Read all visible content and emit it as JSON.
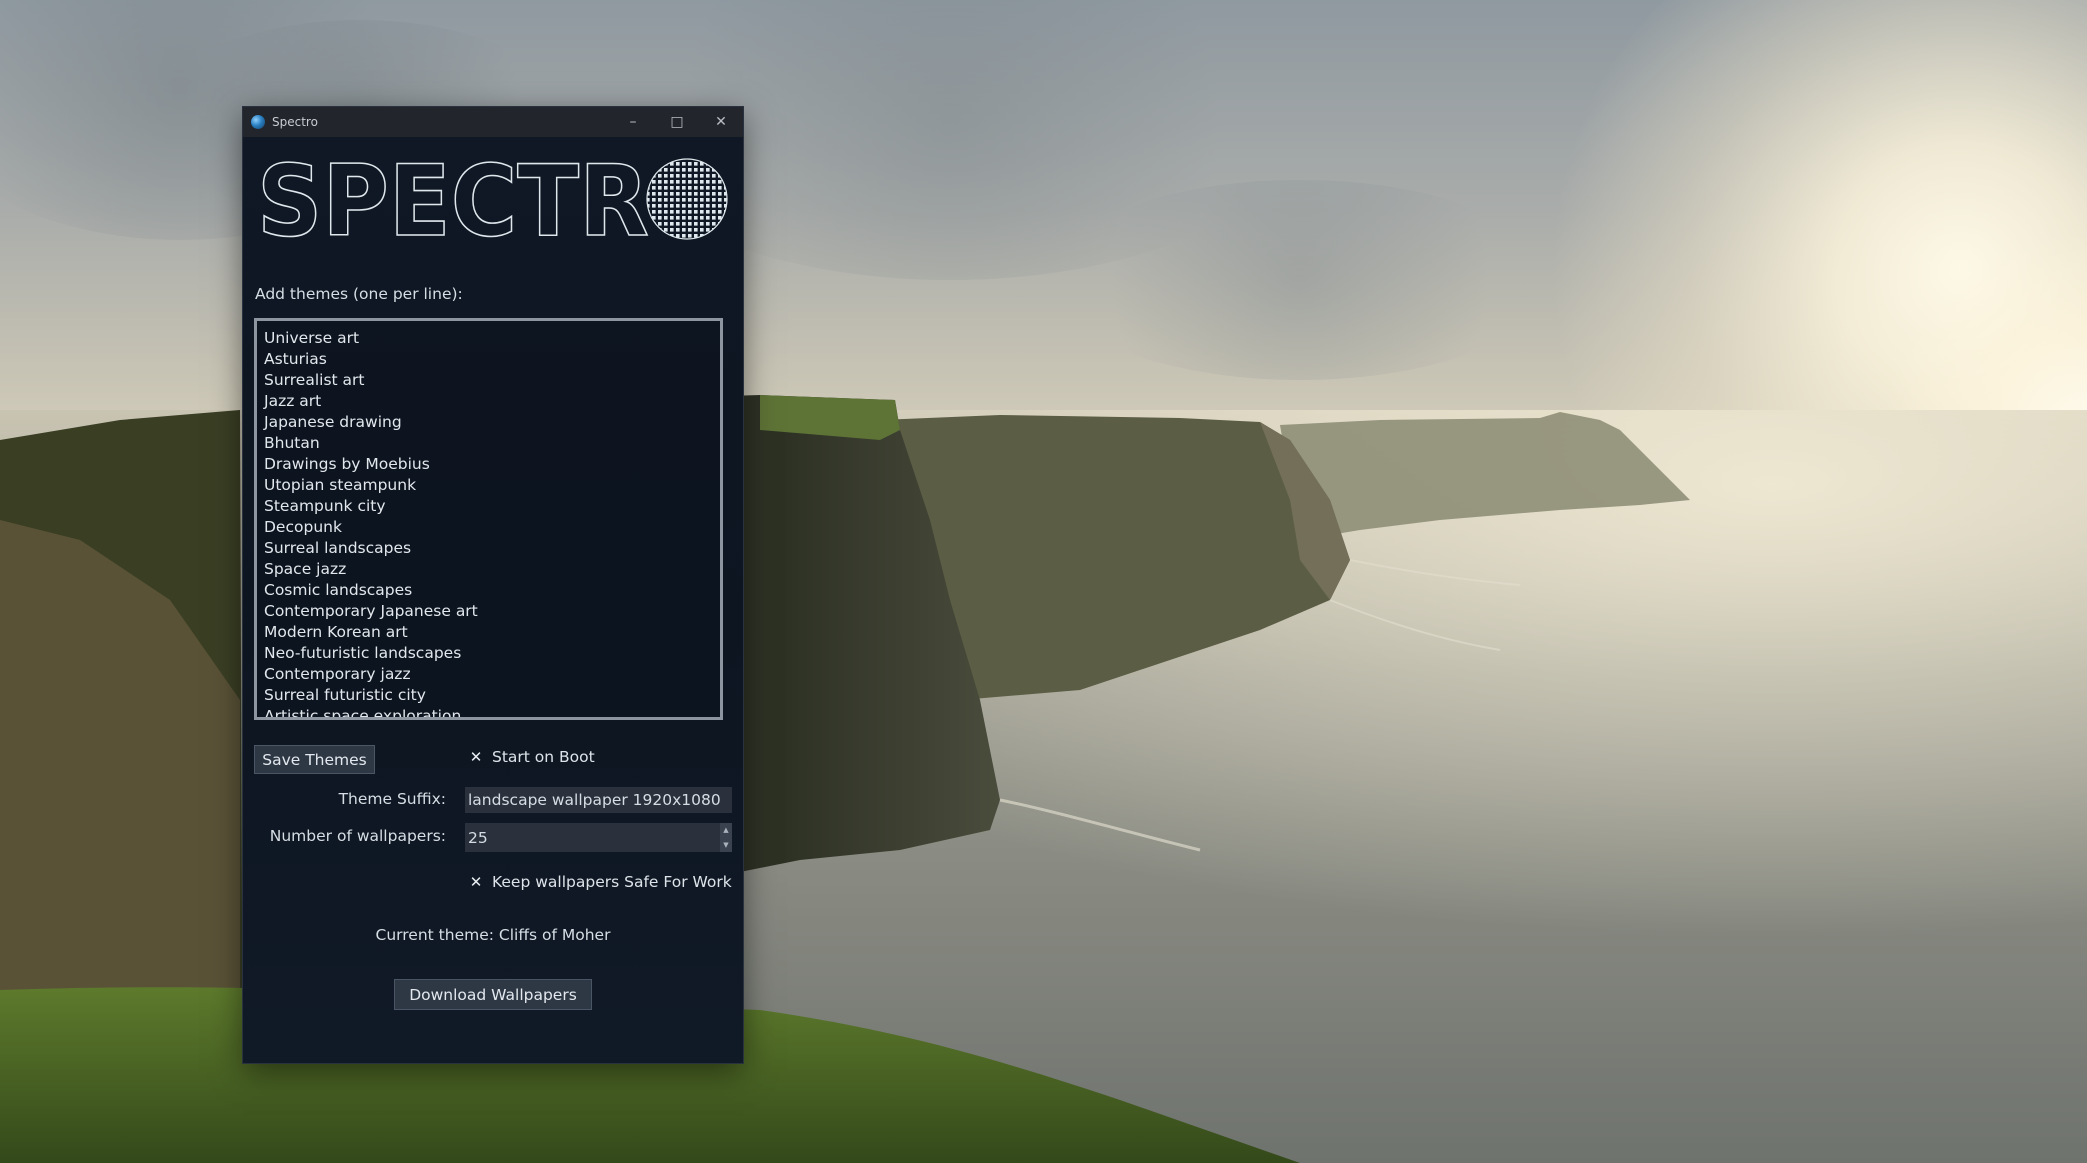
{
  "window": {
    "title": "Spectro",
    "controls": {
      "minimize": "–",
      "maximize": "□",
      "close": "✕"
    }
  },
  "logo": {
    "text": "SPECTR"
  },
  "themes": {
    "label": "Add themes (one per line):",
    "items": [
      "Universe art",
      "Asturias",
      "Surrealist art",
      "Jazz art",
      "Japanese drawing",
      "Bhutan",
      "Drawings by Moebius",
      "Utopian steampunk",
      "Steampunk city",
      "Decopunk",
      "Surreal landscapes",
      "Space jazz",
      "Cosmic landscapes",
      "Contemporary Japanese art",
      "Modern Korean art",
      "Neo-futuristic landscapes",
      "Contemporary jazz",
      "Surreal futuristic city",
      "Artistic space exploration"
    ]
  },
  "save_button": "Save Themes",
  "start_on_boot": {
    "label": "Start on Boot",
    "checked": true,
    "mark": "✕"
  },
  "theme_suffix": {
    "label": "Theme Suffix:",
    "value": "landscape wallpaper 1920x1080"
  },
  "num_wallpapers": {
    "label": "Number of wallpapers:",
    "value": "25",
    "up": "▲",
    "down": "▼"
  },
  "sfw": {
    "label": "Keep wallpapers Safe For Work",
    "checked": true,
    "mark": "✕"
  },
  "current_theme": {
    "text": "Current theme: Cliffs of Moher"
  },
  "download_button": "Download Wallpapers",
  "colors": {
    "window_bg": "#0f1824",
    "titlebar": "#22252b",
    "field_bg": "#2a313c",
    "button_bg": "#2e3744"
  }
}
